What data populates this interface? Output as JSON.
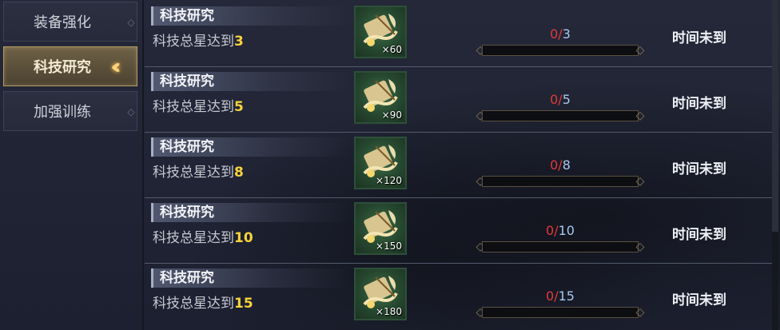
{
  "sidebar": {
    "tabs": [
      {
        "label": "装备强化",
        "active": false
      },
      {
        "label": "科技研究",
        "active": true
      },
      {
        "label": "加强训练",
        "active": false
      }
    ]
  },
  "rows": [
    {
      "title": "科技研究",
      "desc_prefix": "科技总星达到",
      "target": "3",
      "reward_icon": "scroll-quill-icon",
      "reward_count": "×60",
      "progress_current": "0",
      "progress_sep": "/",
      "progress_goal": "3",
      "progress_fraction": 0,
      "status": "时间未到"
    },
    {
      "title": "科技研究",
      "desc_prefix": "科技总星达到",
      "target": "5",
      "reward_icon": "scroll-quill-icon",
      "reward_count": "×90",
      "progress_current": "0",
      "progress_sep": "/",
      "progress_goal": "5",
      "progress_fraction": 0,
      "status": "时间未到"
    },
    {
      "title": "科技研究",
      "desc_prefix": "科技总星达到",
      "target": "8",
      "reward_icon": "scroll-quill-icon",
      "reward_count": "×120",
      "progress_current": "0",
      "progress_sep": "/",
      "progress_goal": "8",
      "progress_fraction": 0,
      "status": "时间未到"
    },
    {
      "title": "科技研究",
      "desc_prefix": "科技总星达到",
      "target": "10",
      "reward_icon": "scroll-quill-icon",
      "reward_count": "×150",
      "progress_current": "0",
      "progress_sep": "/",
      "progress_goal": "10",
      "progress_fraction": 0,
      "status": "时间未到"
    },
    {
      "title": "科技研究",
      "desc_prefix": "科技总星达到",
      "target": "15",
      "reward_icon": "scroll-quill-icon",
      "reward_count": "×180",
      "progress_current": "0",
      "progress_sep": "/",
      "progress_goal": "15",
      "progress_fraction": 0,
      "status": "时间未到"
    }
  ],
  "colors": {
    "highlight_number": "#f7d43c",
    "progress_current": "#e03a3a",
    "progress_goal": "#a7c8ee",
    "active_tab": "#5a4f39"
  }
}
